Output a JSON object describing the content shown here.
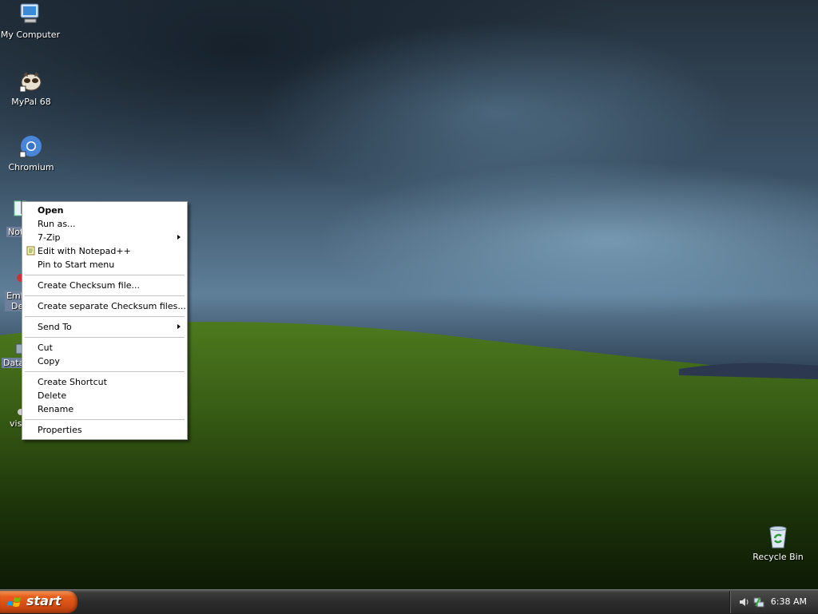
{
  "desktop": {
    "icons": [
      {
        "label": "My Computer",
        "icon": "my-computer-icon"
      },
      {
        "label": "MyPal 68",
        "icon": "mypal-icon"
      },
      {
        "label": "Chromium",
        "icon": "chromium-icon"
      },
      {
        "label": "Not",
        "icon": "notepadpp-icon"
      },
      {
        "label": "Emb",
        "sub": "De",
        "icon": "app-icon"
      },
      {
        "label": "Data",
        "icon": "data-icon"
      },
      {
        "label": "vis",
        "icon": "vis-icon"
      },
      {
        "label": "Recycle Bin",
        "icon": "recycle-bin-icon"
      }
    ]
  },
  "context_menu": {
    "items": [
      {
        "label": "Open",
        "bold": true
      },
      {
        "label": "Run as..."
      },
      {
        "label": "7-Zip",
        "submenu": true
      },
      {
        "label": "Edit with Notepad++",
        "icon": "notepadpp-icon"
      },
      {
        "label": "Pin to Start menu"
      },
      {
        "label": "Create Checksum file..."
      },
      {
        "label": "Create separate Checksum files..."
      },
      {
        "label": "Send To",
        "submenu": true
      },
      {
        "label": "Cut"
      },
      {
        "label": "Copy"
      },
      {
        "label": "Create Shortcut"
      },
      {
        "label": "Delete"
      },
      {
        "label": "Rename"
      },
      {
        "label": "Properties"
      }
    ]
  },
  "taskbar": {
    "start_label": "start",
    "clock": "6:38 AM",
    "tray_icons": [
      "speaker-icon",
      "network-icon"
    ]
  }
}
